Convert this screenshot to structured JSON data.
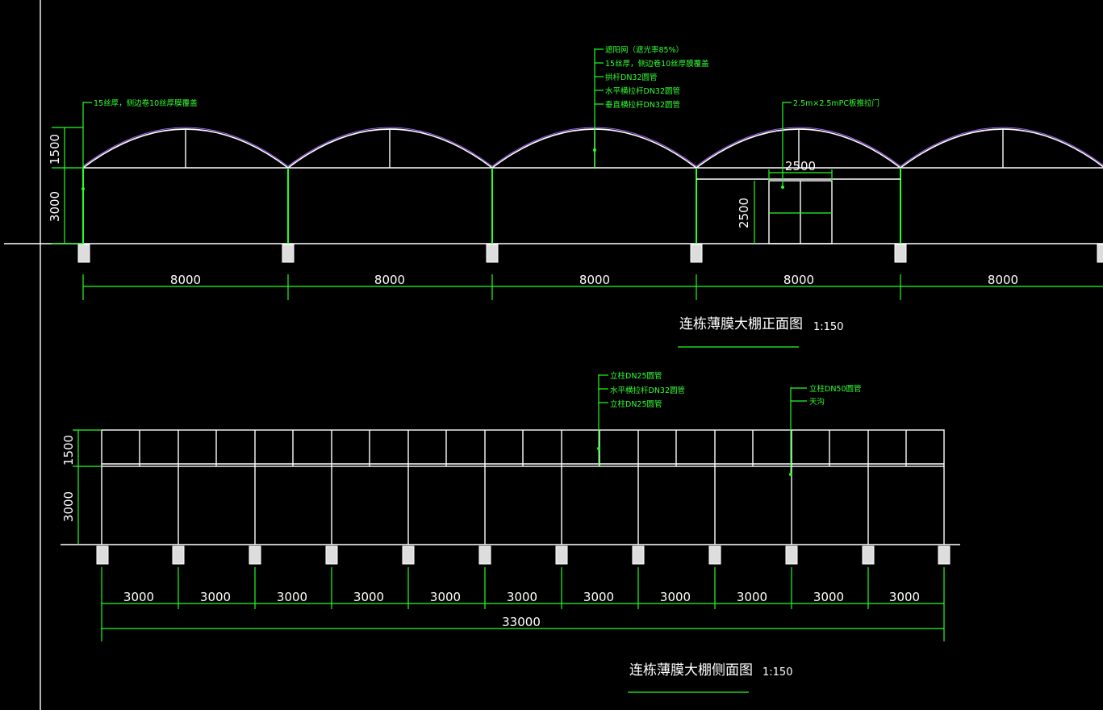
{
  "front": {
    "title": "连栋薄膜大棚正面图",
    "scale": "1:150",
    "span_labels": [
      "8000",
      "8000",
      "8000",
      "8000",
      "8000"
    ],
    "height_upper": "1500",
    "height_lower": "3000",
    "door_width": "2500",
    "door_height": "2500",
    "note_left": "15丝厚，侧边卷10丝厚膜覆盖",
    "notes_center": [
      "遮阳网（遮光率85%）",
      "15丝厚，侧边卷10丝厚膜覆盖",
      "拱杆DN32圆管",
      "水平横拉杆DN32圆管",
      "垂直横拉杆DN32圆管"
    ],
    "note_door": "2.5m×2.5mPC板推拉门"
  },
  "side": {
    "title": "连栋薄膜大棚侧面图",
    "scale": "1:150",
    "bay_labels": [
      "3000",
      "3000",
      "3000",
      "3000",
      "3000",
      "3000",
      "3000",
      "3000",
      "3000",
      "3000",
      "3000"
    ],
    "total": "33000",
    "height_upper": "1500",
    "height_lower": "3000",
    "notes_center": [
      "立柱DN25圆管",
      "水平横拉杆DN32圆管",
      "立柱DN25圆管"
    ],
    "notes_right": [
      "立柱DN50圆管",
      "天沟"
    ]
  },
  "colors": {
    "background": "#000000",
    "lines": "#ffffff",
    "dims": "#22ff22",
    "film": "#aa66ff"
  }
}
